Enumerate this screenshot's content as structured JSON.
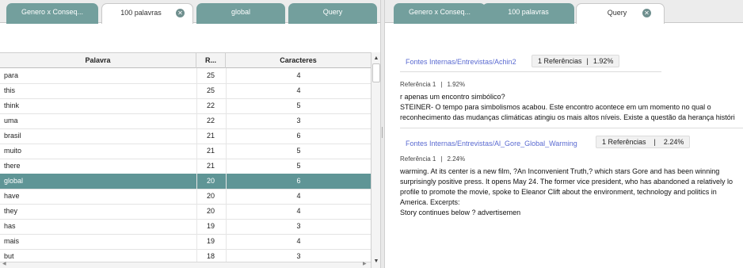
{
  "left": {
    "tabs": [
      {
        "label": "Genero x Conseq...",
        "active": false
      },
      {
        "label": "100 palavras",
        "active": true,
        "closable": true
      },
      {
        "label": "global",
        "active": false
      },
      {
        "label": "Query",
        "active": false
      }
    ],
    "close_glyph": "✕",
    "table": {
      "columns": [
        "Palavra",
        "R...",
        "Caracteres"
      ],
      "rows": [
        {
          "word": "para",
          "count": "25",
          "chars": "4",
          "selected": false
        },
        {
          "word": "this",
          "count": "25",
          "chars": "4",
          "selected": false
        },
        {
          "word": "think",
          "count": "22",
          "chars": "5",
          "selected": false
        },
        {
          "word": "uma",
          "count": "22",
          "chars": "3",
          "selected": false
        },
        {
          "word": "brasil",
          "count": "21",
          "chars": "6",
          "selected": false
        },
        {
          "word": "muito",
          "count": "21",
          "chars": "5",
          "selected": false
        },
        {
          "word": "there",
          "count": "21",
          "chars": "5",
          "selected": false
        },
        {
          "word": "global",
          "count": "20",
          "chars": "6",
          "selected": true
        },
        {
          "word": "have",
          "count": "20",
          "chars": "4",
          "selected": false
        },
        {
          "word": "they",
          "count": "20",
          "chars": "4",
          "selected": false
        },
        {
          "word": "has",
          "count": "19",
          "chars": "3",
          "selected": false
        },
        {
          "word": "mais",
          "count": "19",
          "chars": "4",
          "selected": false
        },
        {
          "word": "but",
          "count": "18",
          "chars": "3",
          "selected": false
        }
      ]
    },
    "scroll_up_glyph": "▲",
    "scroll_down_glyph": "▼",
    "scroll_left_glyph": "◀",
    "scroll_right_glyph": "▶"
  },
  "right": {
    "tabs": [
      {
        "label": "Genero x Conseq...",
        "active": false
      },
      {
        "label": "100 palavras",
        "active": false
      },
      {
        "label": "Query",
        "active": true,
        "closable": true
      }
    ],
    "close_glyph": "✕",
    "results": [
      {
        "source": "Fontes Internas/Entrevistas/Achin2",
        "refs": "1 Referências",
        "coverage": "1.92%",
        "ref_label": "Referência 1",
        "ref_coverage": "1.92%",
        "lines": [
          "r apenas um encontro simbólico?",
          "STEINER- O tempo para simbolismos acabou. Este encontro acontece em um momento no qual o",
          "reconhecimento das mudanças climáticas atingiu os mais altos níveis. Existe a questão da herança históri"
        ]
      },
      {
        "source": "Fontes Internas/Entrevistas/Al_Gore_Global_Warming",
        "refs": "1 Referências",
        "coverage": "2.24%",
        "ref_label": "Referência 1",
        "ref_coverage": "2.24%",
        "lines": [
          "warming. At its center is a new film, ?An Inconvenient Truth,? which stars Gore and has been winning",
          "surprisingly positive press. It opens May 24. The former vice president, who has abandoned a relatively lo",
          "profile to promote the movie, spoke to Eleanor Clift about the environment, technology and politics in",
          "America. Excerpts:",
          "Story continues below ? advertisemen"
        ]
      }
    ],
    "separator": "|"
  },
  "colors": {
    "tab_inactive": "#739f9d",
    "selected_row": "#5f9596",
    "link": "#5a6ad1"
  }
}
